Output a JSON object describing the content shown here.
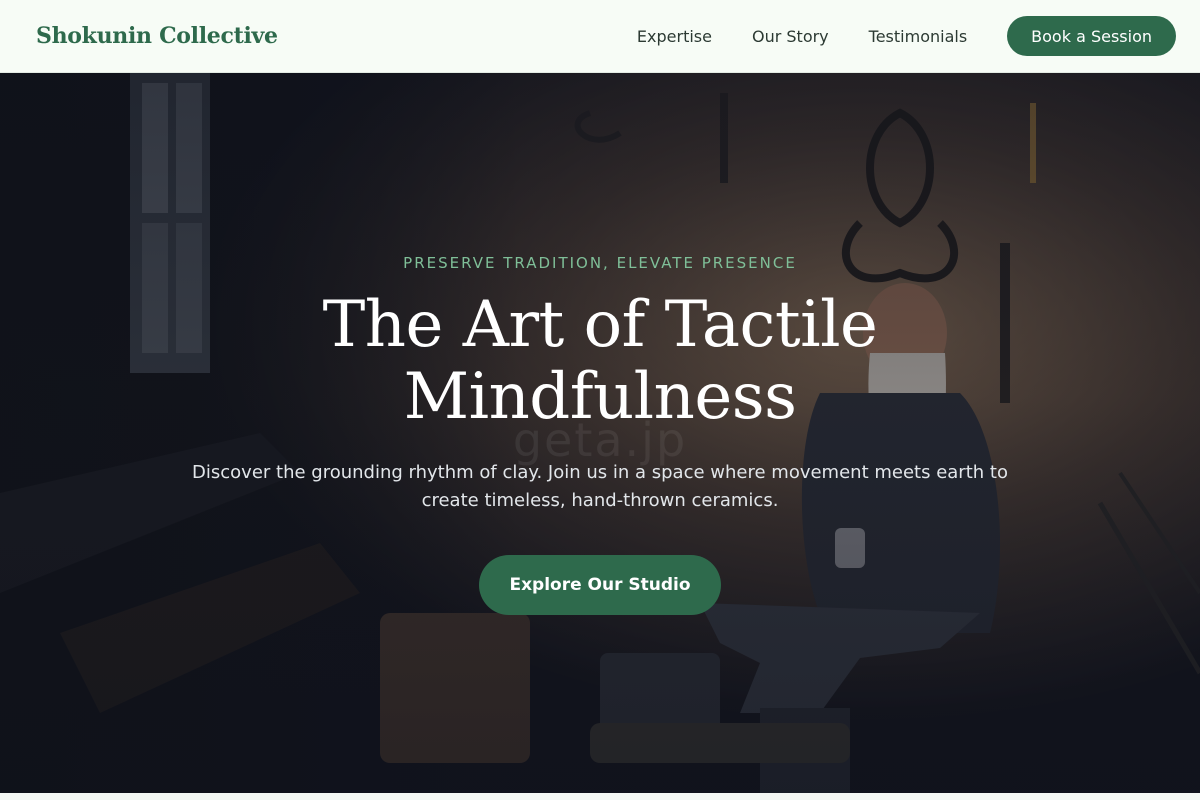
{
  "brand": {
    "name": "Shokunin Collective"
  },
  "nav": {
    "links": [
      "Expertise",
      "Our Story",
      "Testimonials"
    ],
    "cta": "Book a Session"
  },
  "hero": {
    "eyebrow": "PRESERVE TRADITION, ELEVATE PRESENCE",
    "title": "The Art of Tactile Mindfulness",
    "subtitle": "Discover the grounding rhythm of clay. Join us in a space where movement meets earth to create timeless, hand-thrown ceramics.",
    "cta": "Explore Our Studio",
    "watermark": "geta.jp"
  },
  "colors": {
    "accent": "#2e6a4c",
    "eyebrow": "#7fbf98",
    "nav_bg": "#f7fcf6",
    "hero_overlay": "#0d101c"
  },
  "icons": {
    "hero_image": "blacksmith-workshop-photo"
  }
}
